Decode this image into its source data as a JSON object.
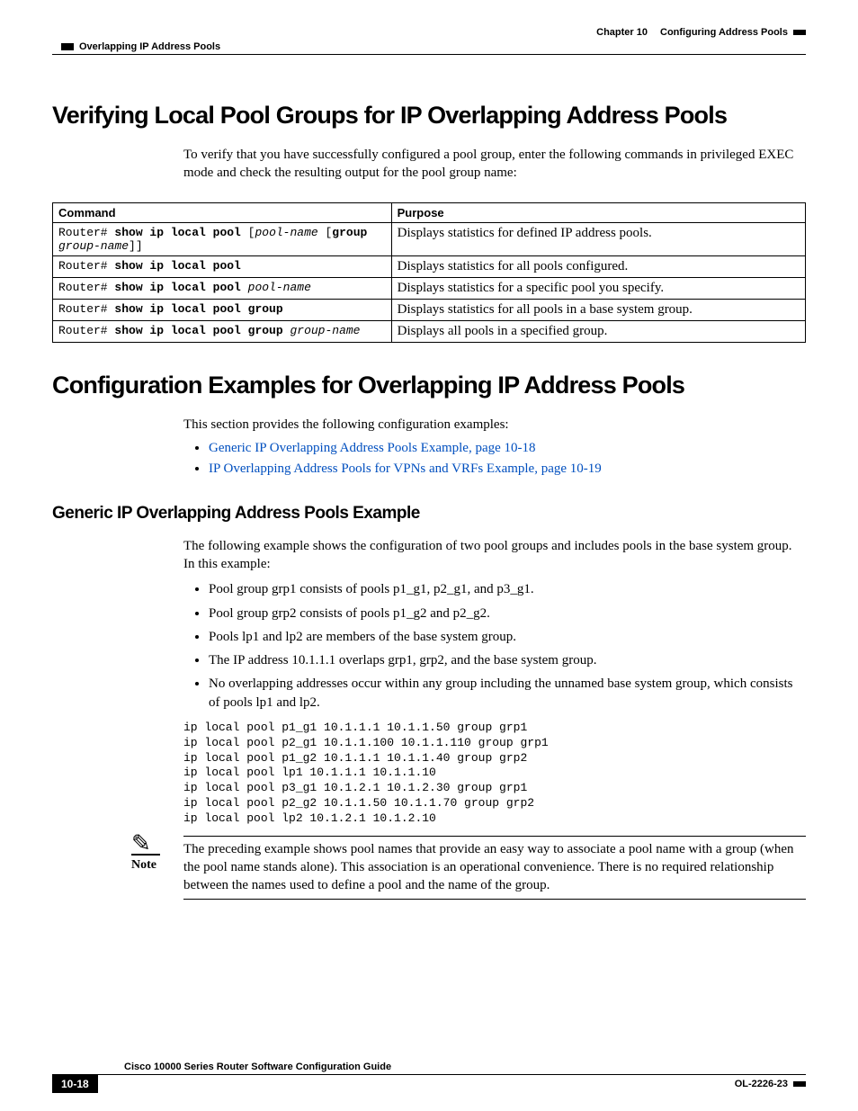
{
  "header": {
    "chapter": "Chapter 10",
    "title": "Configuring Address Pools",
    "running": "Overlapping IP Address Pools"
  },
  "h1_a": "Verifying Local Pool Groups for IP Overlapping Address Pools",
  "intro_a": "To verify that you have successfully configured a pool group, enter the following commands in privileged EXEC mode and check the resulting output for the pool group name:",
  "table": {
    "head_cmd": "Command",
    "head_purpose": "Purpose",
    "rows": [
      {
        "prefix": "Router# ",
        "bold": "show ip local pool",
        "after_plain": " [",
        "after_italic": "pool-name ",
        "after_plain2": "[",
        "bold2": "group",
        "line2_italic": "group-name",
        "line2_plain": "]]",
        "purpose": "Displays statistics for defined IP address pools."
      },
      {
        "prefix": "Router# ",
        "bold": "show ip local pool",
        "purpose": "Displays statistics for all pools configured."
      },
      {
        "prefix": "Router# ",
        "bold": "show ip local pool ",
        "after_italic": "pool-name",
        "purpose": "Displays statistics for a specific pool you specify."
      },
      {
        "prefix": "Router# ",
        "bold": "show ip local pool group",
        "purpose": "Displays statistics for all pools in a base system group."
      },
      {
        "prefix": "Router# ",
        "bold": "show ip local pool group ",
        "after_italic": "group-name",
        "purpose": "Displays all pools in a specified group."
      }
    ]
  },
  "h1_b": "Configuration Examples for Overlapping IP Address Pools",
  "intro_b": "This section provides the following configuration examples:",
  "links": [
    "Generic IP Overlapping Address Pools Example, page 10-18",
    "IP Overlapping Address Pools for VPNs and VRFs Example, page 10-19"
  ],
  "h2_a": "Generic IP Overlapping Address Pools Example",
  "intro_c": "The following example shows the configuration of two pool groups and includes pools in the base system group. In this example:",
  "bullets": [
    "Pool group grp1 consists of pools p1_g1, p2_g1, and p3_g1.",
    "Pool group grp2 consists of pools p1_g2 and p2_g2.",
    "Pools lp1 and lp2 are members of the base system group.",
    "The IP address 10.1.1.1 overlaps grp1, grp2, and the base system group.",
    "No overlapping addresses occur within any group including the unnamed base system group, which consists of pools lp1 and lp2."
  ],
  "code": "ip local pool p1_g1 10.1.1.1 10.1.1.50 group grp1\nip local pool p2_g1 10.1.1.100 10.1.1.110 group grp1\nip local pool p1_g2 10.1.1.1 10.1.1.40 group grp2\nip local pool lp1 10.1.1.1 10.1.1.10\nip local pool p3_g1 10.1.2.1 10.1.2.30 group grp1\nip local pool p2_g2 10.1.1.50 10.1.1.70 group grp2\nip local pool lp2 10.1.2.1 10.1.2.10",
  "note_label": "Note",
  "note": "The preceding example shows pool names that provide an easy way to associate a pool name with a group (when the pool name stands alone). This association is an operational convenience. There is no required relationship between the names used to define a pool and the name of the group.",
  "footer": {
    "title": "Cisco 10000 Series Router Software Configuration Guide",
    "page": "10-18",
    "docid": "OL-2226-23"
  }
}
